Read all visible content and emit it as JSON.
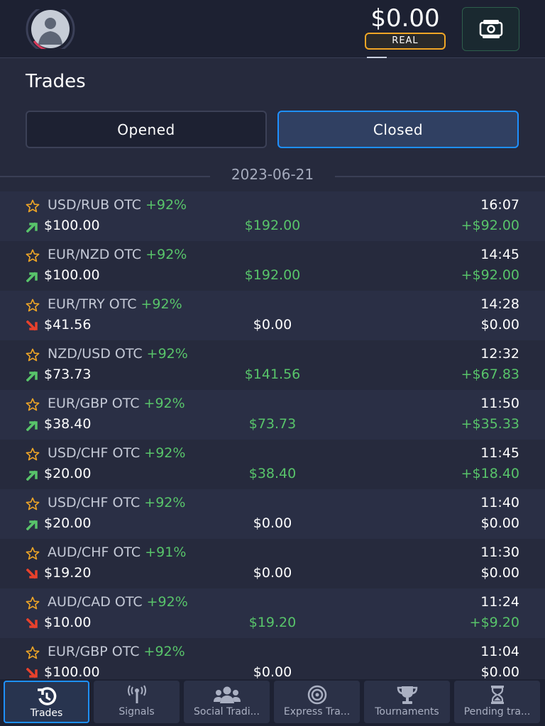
{
  "header": {
    "balance": "$0.00",
    "account_type": "REAL"
  },
  "page": {
    "title": "Trades",
    "tabs": [
      {
        "label": "Opened",
        "active": false
      },
      {
        "label": "Closed",
        "active": true
      }
    ],
    "date": "2023-06-21"
  },
  "trades": [
    {
      "pair": "USD/RUB OTC",
      "pct": "+92%",
      "time": "16:07",
      "direction": "up",
      "stake": "$100.00",
      "payout": "$192.00",
      "profit": "+$92.00",
      "win": true
    },
    {
      "pair": "EUR/NZD OTC",
      "pct": "+92%",
      "time": "14:45",
      "direction": "up",
      "stake": "$100.00",
      "payout": "$192.00",
      "profit": "+$92.00",
      "win": true
    },
    {
      "pair": "EUR/TRY OTC",
      "pct": "+92%",
      "time": "14:28",
      "direction": "down",
      "stake": "$41.56",
      "payout": "$0.00",
      "profit": "$0.00",
      "win": false
    },
    {
      "pair": "NZD/USD OTC",
      "pct": "+92%",
      "time": "12:32",
      "direction": "up",
      "stake": "$73.73",
      "payout": "$141.56",
      "profit": "+$67.83",
      "win": true
    },
    {
      "pair": "EUR/GBP OTC",
      "pct": "+92%",
      "time": "11:50",
      "direction": "up",
      "stake": "$38.40",
      "payout": "$73.73",
      "profit": "+$35.33",
      "win": true
    },
    {
      "pair": "USD/CHF OTC",
      "pct": "+92%",
      "time": "11:45",
      "direction": "up",
      "stake": "$20.00",
      "payout": "$38.40",
      "profit": "+$18.40",
      "win": true
    },
    {
      "pair": "USD/CHF OTC",
      "pct": "+92%",
      "time": "11:40",
      "direction": "up",
      "stake": "$20.00",
      "payout": "$0.00",
      "profit": "$0.00",
      "win": false
    },
    {
      "pair": "AUD/CHF OTC",
      "pct": "+91%",
      "time": "11:30",
      "direction": "down",
      "stake": "$19.20",
      "payout": "$0.00",
      "profit": "$0.00",
      "win": false
    },
    {
      "pair": "AUD/CAD OTC",
      "pct": "+92%",
      "time": "11:24",
      "direction": "down",
      "stake": "$10.00",
      "payout": "$19.20",
      "profit": "+$9.20",
      "win": true
    },
    {
      "pair": "EUR/GBP OTC",
      "pct": "+92%",
      "time": "11:04",
      "direction": "down",
      "stake": "$100.00",
      "payout": "$0.00",
      "profit": "$0.00",
      "win": false
    }
  ],
  "bottom_nav": [
    {
      "label": "Trades",
      "icon": "history-icon",
      "active": true
    },
    {
      "label": "Signals",
      "icon": "antenna-icon",
      "active": false
    },
    {
      "label": "Social Tradi...",
      "icon": "users-icon",
      "active": false
    },
    {
      "label": "Express Tra...",
      "icon": "target-icon",
      "active": false
    },
    {
      "label": "Tournaments",
      "icon": "trophy-icon",
      "active": false
    },
    {
      "label": "Pending tra...",
      "icon": "hourglass-icon",
      "active": false
    }
  ],
  "colors": {
    "background": "#262a3d",
    "header": "#1d2132",
    "green": "#58c46a",
    "red": "#e8412c",
    "accent": "#1e90ff",
    "star": "#f0a626"
  }
}
